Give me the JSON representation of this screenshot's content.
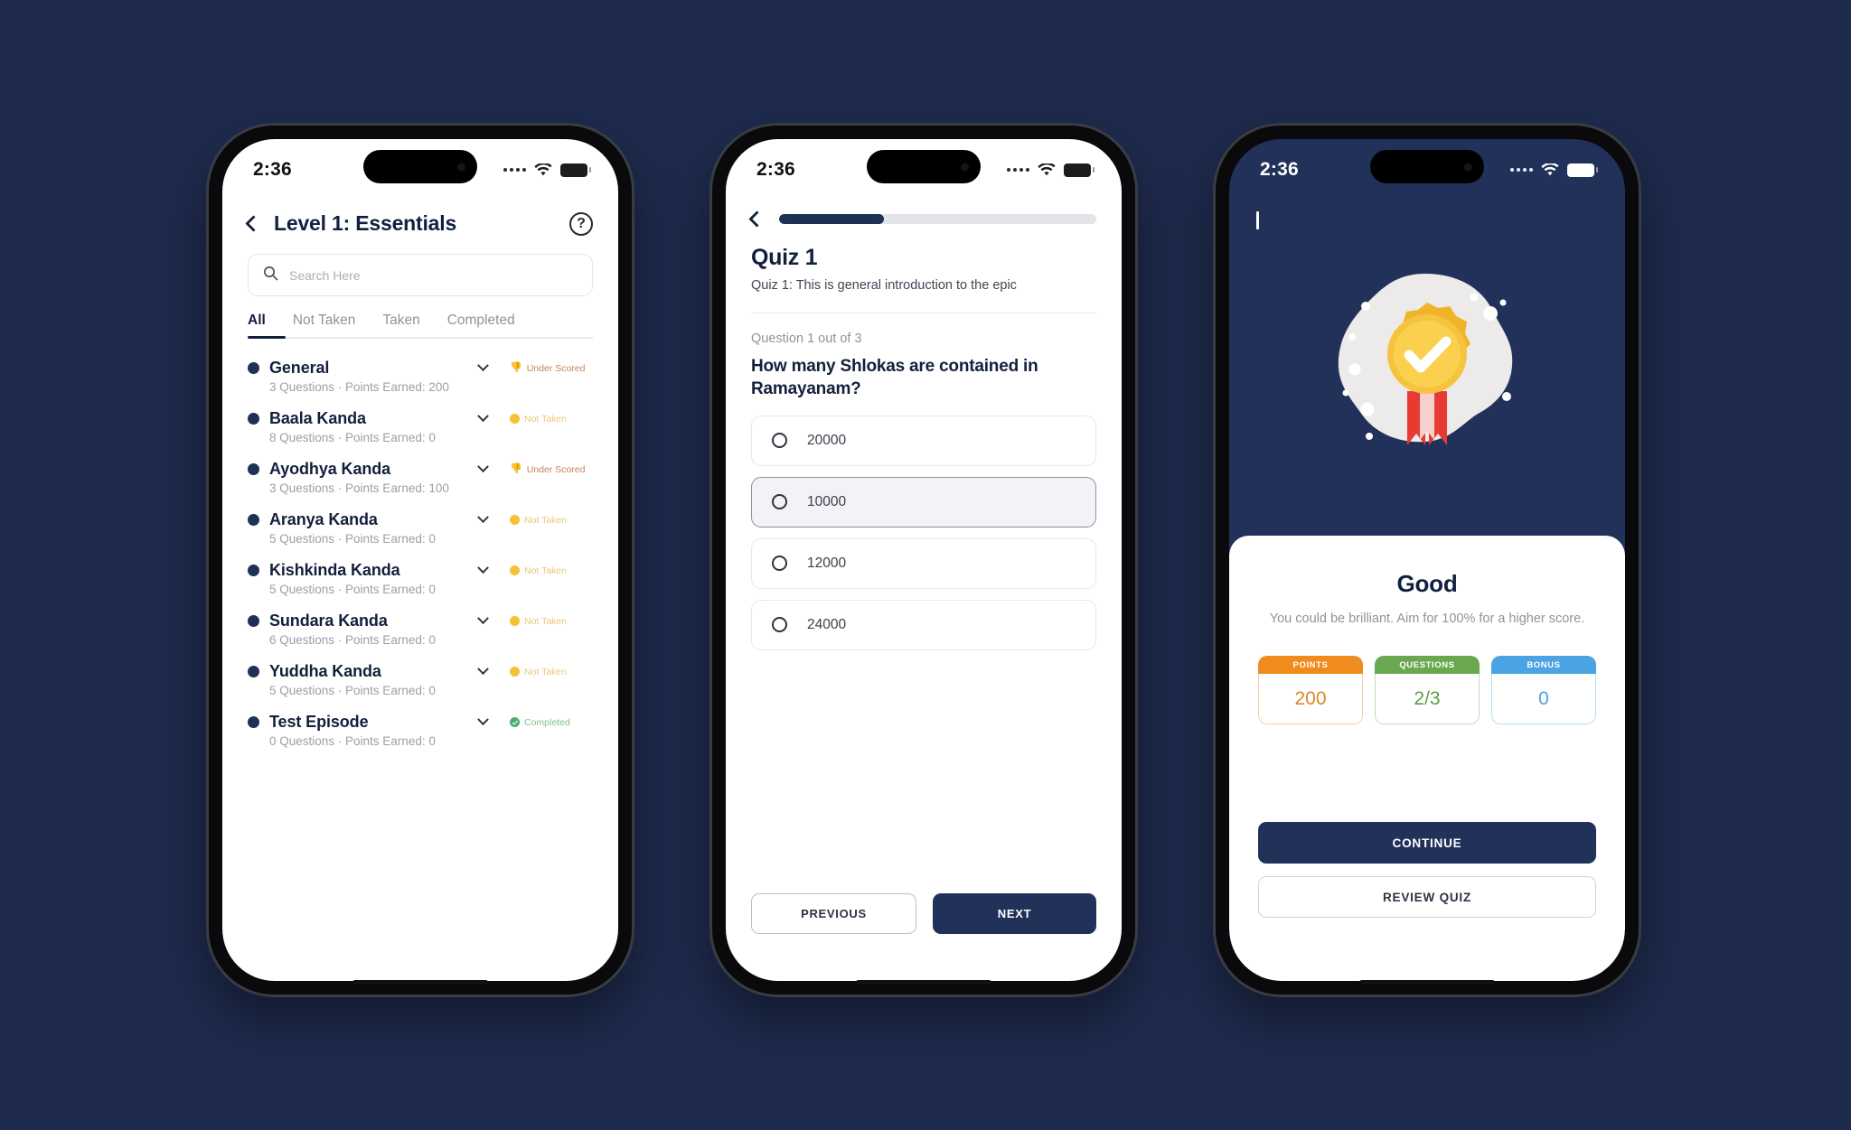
{
  "colors": {
    "page_background": "#1e2b4d",
    "navy": "#22315a",
    "accent_dark": "#13203c",
    "points_orange": "#f08c1e",
    "questions_green": "#6aa84f",
    "bonus_blue": "#4ba3e3",
    "selected_option": "#f4f1f7"
  },
  "phone1": {
    "status": {
      "time": "2:36",
      "wifi_icon": "wifi-icon",
      "battery_icon": "battery-icon",
      "signal_icon": "signal-dots-icon"
    },
    "header": {
      "back_icon": "chevron-left-icon",
      "title": "Level 1: Essentials",
      "help_icon": "help-circle-icon",
      "help_glyph": "?"
    },
    "search": {
      "icon": "search-icon",
      "placeholder": "Search Here",
      "value": ""
    },
    "tabs": [
      {
        "label": "All",
        "active": true
      },
      {
        "label": "Not Taken",
        "active": false
      },
      {
        "label": "Taken",
        "active": false
      },
      {
        "label": "Completed",
        "active": false
      }
    ],
    "list": [
      {
        "name": "General",
        "meta": "3 Questions · Points Earned: 200",
        "status": "Under Scored",
        "status_type": "under"
      },
      {
        "name": "Baala Kanda",
        "meta": "8 Questions · Points Earned: 0",
        "status": "Not Taken",
        "status_type": "not"
      },
      {
        "name": "Ayodhya Kanda",
        "meta": "3 Questions · Points Earned: 100",
        "status": "Under Scored",
        "status_type": "under"
      },
      {
        "name": "Aranya Kanda",
        "meta": "5 Questions · Points Earned: 0",
        "status": "Not Taken",
        "status_type": "not"
      },
      {
        "name": "Kishkinda Kanda",
        "meta": "5 Questions · Points Earned: 0",
        "status": "Not Taken",
        "status_type": "not"
      },
      {
        "name": "Sundara Kanda",
        "meta": "6 Questions · Points Earned: 0",
        "status": "Not Taken",
        "status_type": "not"
      },
      {
        "name": "Yuddha Kanda",
        "meta": "5 Questions · Points Earned: 0",
        "status": "Not Taken",
        "status_type": "not"
      },
      {
        "name": "Test Episode",
        "meta": "0 Questions · Points Earned: 0",
        "status": "Completed",
        "status_type": "done"
      }
    ]
  },
  "phone2": {
    "status": {
      "time": "2:36"
    },
    "header": {
      "back_icon": "chevron-left-icon",
      "progress_percent": 33
    },
    "quiz": {
      "title": "Quiz 1",
      "description": "Quiz 1: This is general introduction to the epic",
      "counter": "Question 1 out of 3",
      "question": "How many Shlokas are contained in Ramayanam?",
      "options": [
        {
          "label": "20000",
          "selected": false
        },
        {
          "label": "10000",
          "selected": true
        },
        {
          "label": "12000",
          "selected": false
        },
        {
          "label": "24000",
          "selected": false
        }
      ]
    },
    "footer": {
      "previous_label": "PREVIOUS",
      "next_label": "NEXT"
    }
  },
  "phone3": {
    "status": {
      "time": "2:36"
    },
    "header": {
      "back_icon": "chevron-left-icon"
    },
    "badge_icon": "award-medal-icon",
    "result": {
      "title": "Good",
      "subtitle": "You could be brilliant. Aim for 100% for a higher score.",
      "stats": [
        {
          "label": "POINTS",
          "value": "200",
          "header_color": "#f08c1e",
          "value_color": "#d98a2b",
          "border_color": "#f3cfa4"
        },
        {
          "label": "QUESTIONS",
          "value": "2/3",
          "header_color": "#6aa84f",
          "value_color": "#5e9e46",
          "border_color": "#bfdcb0"
        },
        {
          "label": "BONUS",
          "value": "0",
          "header_color": "#4ba3e3",
          "value_color": "#4ba3e3",
          "border_color": "#b5dcf5"
        }
      ],
      "continue_label": "CONTINUE",
      "review_label": "REVIEW QUIZ"
    }
  }
}
